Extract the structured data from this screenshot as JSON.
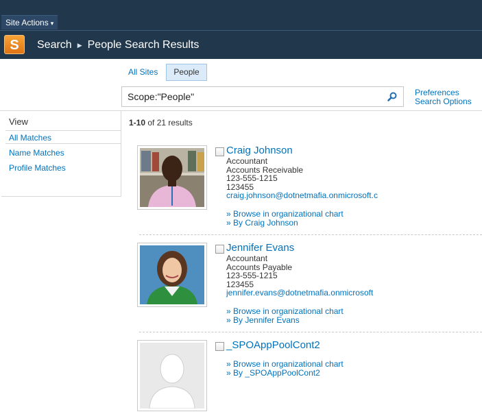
{
  "ribbon": {
    "site_actions": "Site Actions"
  },
  "header": {
    "crumb_root": "Search",
    "crumb_page": "People Search Results",
    "logo_letter": "S"
  },
  "tabs": [
    {
      "label": "All Sites"
    },
    {
      "label": "People"
    }
  ],
  "search": {
    "value": "Scope:\"People\""
  },
  "preferences": {
    "line1": "Preferences",
    "line2": "Search Options"
  },
  "leftnav": {
    "title": "View",
    "items": [
      {
        "label": "All Matches"
      },
      {
        "label": "Name Matches"
      },
      {
        "label": "Profile Matches"
      }
    ]
  },
  "results_info": {
    "range": "1-10",
    "text": " of 21 results"
  },
  "results": [
    {
      "name": "Craig Johnson",
      "title": "Accountant",
      "department": "Accounts Receivable",
      "phone": "123-555-1215",
      "ext": "123455",
      "email": "craig.johnson@dotnetmafia.onmicrosoft.c",
      "org_chart": "» Browse in organizational chart",
      "by": "» By Craig Johnson"
    },
    {
      "name": "Jennifer Evans",
      "title": "Accountant",
      "department": "Accounts Payable",
      "phone": "123-555-1215",
      "ext": "123455",
      "email": "jennifer.evans@dotnetmafia.onmicrosoft",
      "org_chart": "» Browse in organizational chart",
      "by": "» By Jennifer Evans"
    },
    {
      "name": "_SPOAppPoolCont2",
      "org_chart": "» Browse in organizational chart",
      "by": "» By _SPOAppPoolCont2"
    }
  ]
}
